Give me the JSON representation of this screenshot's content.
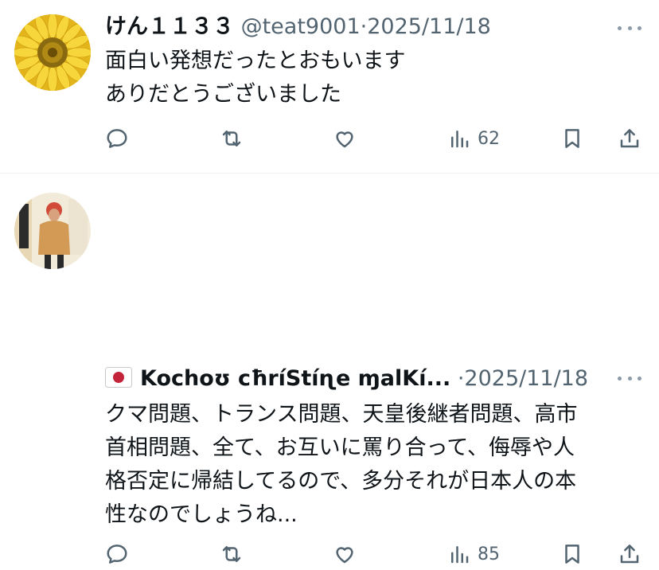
{
  "replies": [
    {
      "name": "けん１１３３",
      "handle": "@teat9001",
      "separator": "·",
      "date": "2025/11/18",
      "text_lines": [
        "面白い発想だったとおもいます",
        "ありだとうございました"
      ],
      "views": "62",
      "avatar": "sunflower-photo"
    },
    {
      "name": "Kochoʊ cħríStíɳe ɱalKí...",
      "handle": "",
      "separator": "·",
      "date": "2025/11/18",
      "text_lines": [
        "クマ問題、トランス問題、天皇後継者問題、高市",
        "首相問題、全て、お互いに罵り合って、侮辱や人",
        "格否定に帰結してるので、多分それが日本人の本",
        "性なのでしょうね..."
      ],
      "views": "85",
      "avatar": "person-photo",
      "flag": "japan-flag-icon"
    }
  ],
  "icons": [
    "reply-icon",
    "retweet-icon",
    "like-icon",
    "views-icon",
    "bookmark-icon",
    "share-icon",
    "more-icon"
  ],
  "colors": {
    "text": "#0f1419",
    "secondary": "#536471",
    "divider": "#eff3f4"
  }
}
